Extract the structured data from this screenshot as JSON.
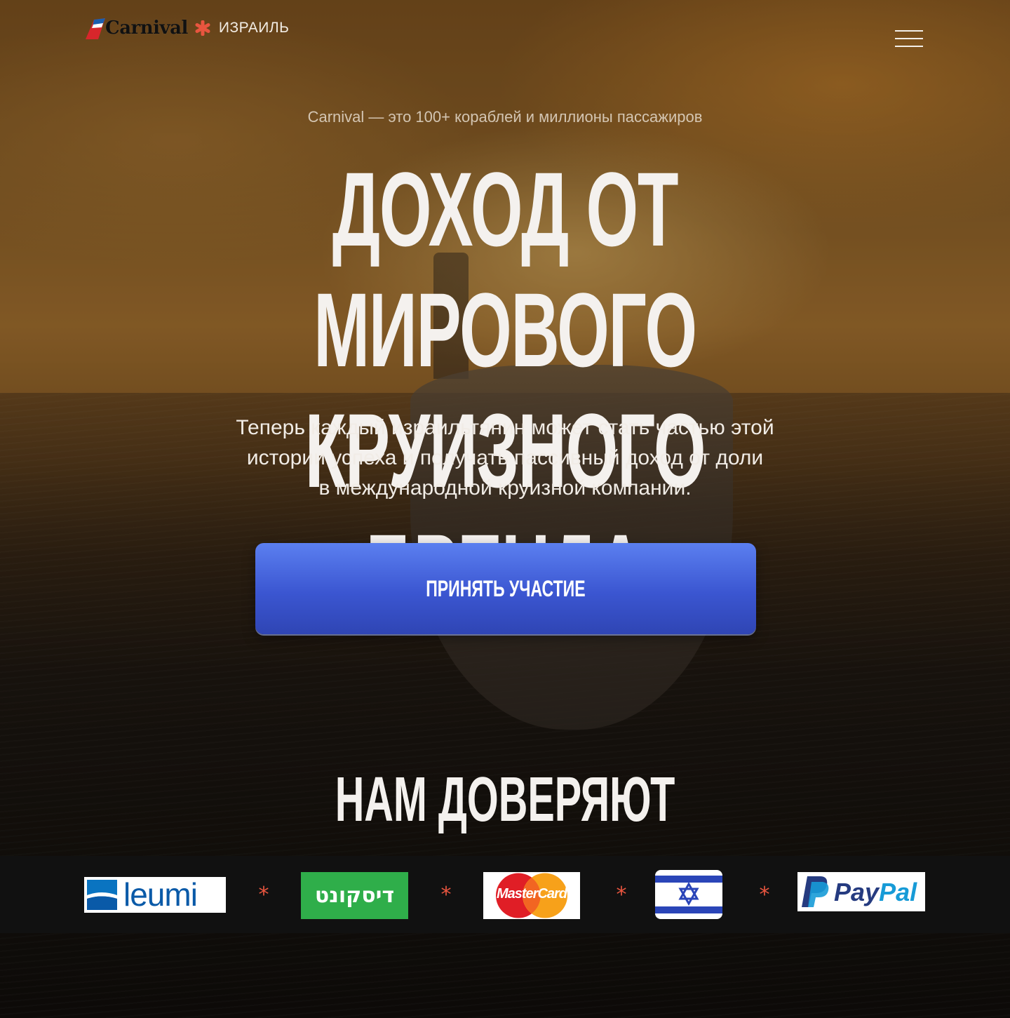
{
  "header": {
    "brand": "Carnival",
    "country": "ИЗРАИЛЬ",
    "menu_icon": "hamburger-menu-icon"
  },
  "hero": {
    "kicker": "Carnival — это 100+ кораблей и миллионы пассажиров",
    "headline_line1": "ДОХОД ОТ МИРОВОГО",
    "headline_line2": "КРУИЗНОГО БРЕНДА",
    "lead_line1": "Теперь каждый израильтянин может стать частью этой",
    "lead_line2": "истории успеха и получать пассивный доход от доли",
    "lead_line3": "в международной круизной компании.",
    "cta_label": "ПРИНЯТЬ УЧАСТИЕ"
  },
  "trust": {
    "title": "НАМ ДОВЕРЯЮТ",
    "partners": [
      {
        "name": "leumi",
        "label": "leumi"
      },
      {
        "name": "discount",
        "label": "דיסקונט"
      },
      {
        "name": "mastercard",
        "label": "MasterCard"
      },
      {
        "name": "israel-flag",
        "label": ""
      },
      {
        "name": "paypal",
        "label_a": "Pay",
        "label_b": "Pal"
      }
    ],
    "separator": "*"
  },
  "colors": {
    "accent_red": "#e8553f",
    "cta_blue": "#3b56d1",
    "strip_bg": "#111111"
  }
}
